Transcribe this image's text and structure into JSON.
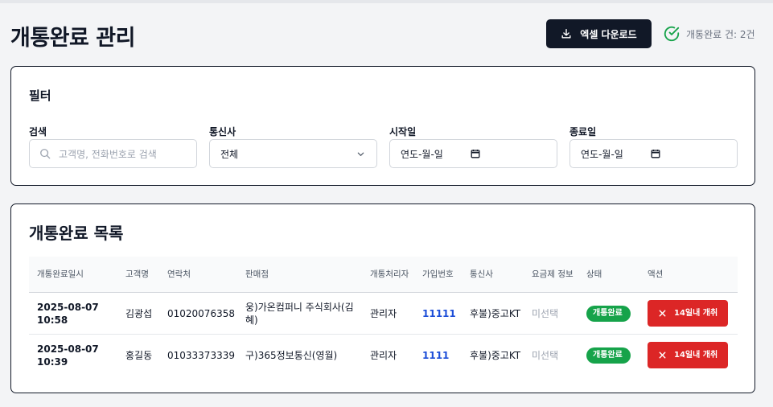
{
  "header": {
    "title": "개통완료 관리",
    "excel_button_label": "엑셀 다운로드",
    "count_text": "개통완료 건: 2건"
  },
  "filter": {
    "title": "필터",
    "search_label": "검색",
    "search_placeholder": "고객명, 전화번호로 검색",
    "carrier_label": "통신사",
    "carrier_value": "전체",
    "start_label": "시작일",
    "start_placeholder": "연도-월-일",
    "end_label": "종료일",
    "end_placeholder": "연도-월-일"
  },
  "list": {
    "title": "개통완료 목록",
    "columns": [
      "개통완료일시",
      "고객명",
      "연락처",
      "판매점",
      "개통처리자",
      "가입번호",
      "통신사",
      "요금제 정보",
      "상태",
      "액션"
    ],
    "rows": [
      {
        "datetime": "2025-08-07 10:58",
        "customer": "김광섭",
        "phone": "01020076358",
        "store": "웅)가온컴퍼니 주식회사(김혜)",
        "processor": "관리자",
        "subscription_no": "11111",
        "carrier": "후불)중고KT",
        "plan": "미선택",
        "status": "개통완료",
        "action": "14일내 개취"
      },
      {
        "datetime": "2025-08-07 10:39",
        "customer": "홍길동",
        "phone": "01033373339",
        "store": "구)365정보통신(영월)",
        "processor": "관리자",
        "subscription_no": "1111",
        "carrier": "후불)중고KT",
        "plan": "미선택",
        "status": "개통완료",
        "action": "14일내 개취"
      }
    ]
  },
  "colors": {
    "primary_dark": "#111827",
    "status_green": "#16a34a",
    "danger_red": "#dc2626",
    "link_blue": "#1d4ed8"
  },
  "icons": [
    "download-icon",
    "check-circle-icon",
    "search-icon",
    "chevron-down-icon",
    "calendar-icon",
    "close-icon"
  ]
}
